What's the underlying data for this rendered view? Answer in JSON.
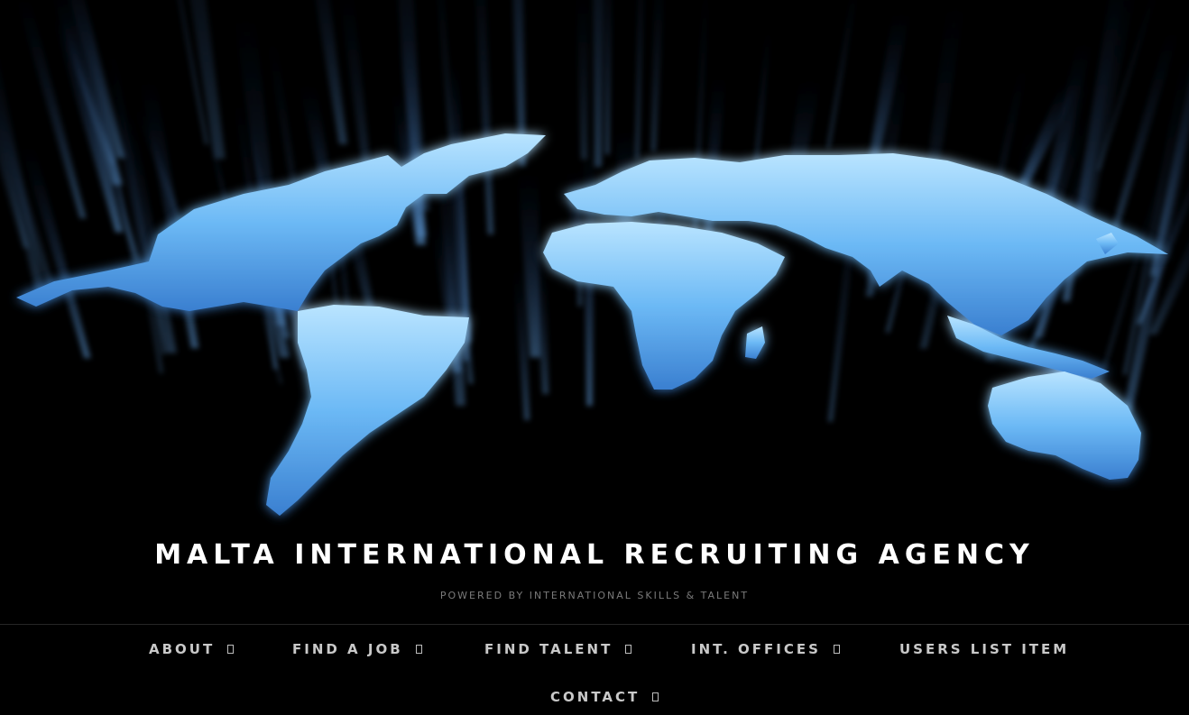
{
  "site": {
    "title": "MALTA INTERNATIONAL RECRUITING AGENCY",
    "tagline": "POWERED BY INTERNATIONAL SKILLS & TALENT"
  },
  "hero": {
    "image": "glowing-world-map",
    "colors": {
      "background": "#000000",
      "glow": "#5aa8f0",
      "highlight": "#a9dcff"
    }
  },
  "nav": {
    "items": [
      {
        "label": "ABOUT",
        "has_submenu": true
      },
      {
        "label": "FIND A JOB",
        "has_submenu": true
      },
      {
        "label": "FIND TALENT",
        "has_submenu": true
      },
      {
        "label": "INT. OFFICES",
        "has_submenu": true
      },
      {
        "label": "USERS LIST ITEM",
        "has_submenu": false
      },
      {
        "label": "CONTACT",
        "has_submenu": true
      }
    ],
    "submenu_icon": "dropdown-indicator-icon"
  }
}
